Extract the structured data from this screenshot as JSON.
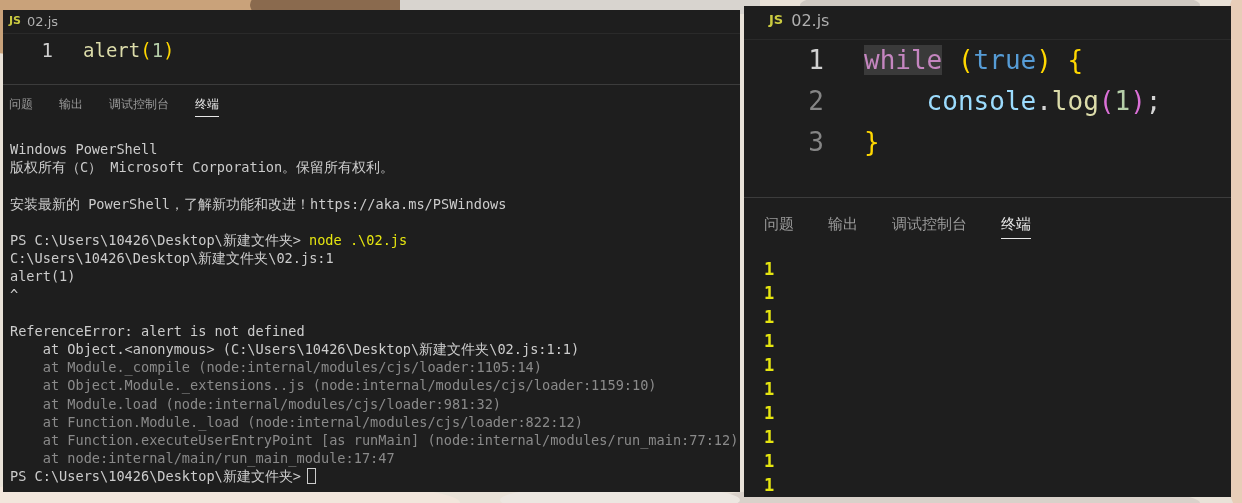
{
  "left_window": {
    "tab": {
      "icon": "JS",
      "label": "02.js"
    },
    "code": [
      {
        "number": "1",
        "tokens": [
          {
            "kind": "func",
            "text": "alert"
          },
          {
            "kind": "paren",
            "text": "("
          },
          {
            "kind": "number",
            "text": "1"
          },
          {
            "kind": "paren",
            "text": ")"
          }
        ]
      }
    ],
    "panel_tabs": [
      {
        "label": "问题",
        "selected": false
      },
      {
        "label": "输出",
        "selected": false
      },
      {
        "label": "调试控制台",
        "selected": false
      },
      {
        "label": "终端",
        "selected": true
      }
    ],
    "terminal": [
      {
        "kind": "text",
        "text": "Windows PowerShell"
      },
      {
        "kind": "text",
        "text": "版权所有（C） Microsoft Corporation。保留所有权利。"
      },
      {
        "kind": "blank"
      },
      {
        "kind": "text",
        "text": "安装最新的 PowerShell，了解新功能和改进！https://aka.ms/PSWindows"
      },
      {
        "kind": "blank"
      },
      {
        "kind": "command",
        "prompt": "PS C:\\Users\\10426\\Desktop\\新建文件夹>",
        "command": "node .\\02.js"
      },
      {
        "kind": "text",
        "text": "C:\\Users\\10426\\Desktop\\新建文件夹\\02.js:1"
      },
      {
        "kind": "text",
        "text": "alert(1)"
      },
      {
        "kind": "text",
        "text": "^"
      },
      {
        "kind": "blank"
      },
      {
        "kind": "text",
        "text": "ReferenceError: alert is not defined"
      },
      {
        "kind": "text",
        "text": "    at Object.<anonymous> (C:\\Users\\10426\\Desktop\\新建文件夹\\02.js:1:1)"
      },
      {
        "kind": "dim",
        "text": "    at Module._compile (node:internal/modules/cjs/loader:1105:14)"
      },
      {
        "kind": "dim",
        "text": "    at Object.Module._extensions..js (node:internal/modules/cjs/loader:1159:10)"
      },
      {
        "kind": "dim",
        "text": "    at Module.load (node:internal/modules/cjs/loader:981:32)"
      },
      {
        "kind": "dim",
        "text": "    at Function.Module._load (node:internal/modules/cjs/loader:822:12)"
      },
      {
        "kind": "dim",
        "text": "    at Function.executeUserEntryPoint [as runMain] (node:internal/modules/run_main:77:12)"
      },
      {
        "kind": "dim",
        "text": "    at node:internal/main/run_main_module:17:47"
      },
      {
        "kind": "cursor",
        "prompt": "PS C:\\Users\\10426\\Desktop\\新建文件夹>"
      }
    ]
  },
  "right_window": {
    "tab": {
      "icon": "JS",
      "label": "02.js"
    },
    "code": [
      {
        "number": "1",
        "tokens": [
          {
            "kind": "keyword",
            "text": "while",
            "highlighted": true
          },
          {
            "kind": "paren",
            "text": " ("
          },
          {
            "kind": "bool",
            "text": "true"
          },
          {
            "kind": "paren",
            "text": ")"
          },
          {
            "kind": "paren",
            "text": " {"
          }
        ]
      },
      {
        "number": "2",
        "tokens": [
          {
            "kind": "ident",
            "text": "    console"
          },
          {
            "kind": "punct",
            "text": "."
          },
          {
            "kind": "func",
            "text": "log"
          },
          {
            "kind": "paren2",
            "text": "("
          },
          {
            "kind": "number",
            "text": "1"
          },
          {
            "kind": "paren2",
            "text": ")"
          },
          {
            "kind": "punct",
            "text": ";"
          }
        ]
      },
      {
        "number": "3",
        "tokens": [
          {
            "kind": "paren",
            "text": "}"
          }
        ]
      }
    ],
    "panel_tabs": [
      {
        "label": "问题",
        "selected": false
      },
      {
        "label": "输出",
        "selected": false
      },
      {
        "label": "调试控制台",
        "selected": false
      },
      {
        "label": "终端",
        "selected": true
      }
    ],
    "terminal": [
      {
        "kind": "output",
        "text": "1"
      },
      {
        "kind": "output",
        "text": "1"
      },
      {
        "kind": "output",
        "text": "1"
      },
      {
        "kind": "output",
        "text": "1"
      },
      {
        "kind": "output",
        "text": "1"
      },
      {
        "kind": "output",
        "text": "1"
      },
      {
        "kind": "output",
        "text": "1"
      },
      {
        "kind": "output",
        "text": "1"
      },
      {
        "kind": "output",
        "text": "1"
      },
      {
        "kind": "output",
        "text": "1"
      }
    ]
  }
}
